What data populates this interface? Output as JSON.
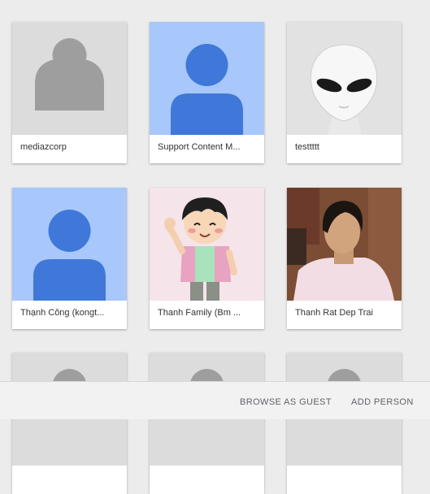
{
  "profiles": [
    {
      "name": "mediazcorp",
      "avatar": "default-gray-person-icon"
    },
    {
      "name": "Support Content M...",
      "avatar": "default-blue-person-icon"
    },
    {
      "name": "testtttt",
      "avatar": "alien-photo"
    },
    {
      "name": "Thạnh Công (kongt...",
      "avatar": "default-blue-person-icon"
    },
    {
      "name": "Thanh Family (Bm ...",
      "avatar": "cartoon-boy-photo"
    },
    {
      "name": "Thanh Rat Dep Trai",
      "avatar": "man-photo"
    },
    {
      "name": "",
      "avatar": "default-gray-person-icon"
    },
    {
      "name": "",
      "avatar": "default-gray-person-icon"
    },
    {
      "name": "",
      "avatar": "default-gray-person-icon"
    }
  ],
  "footer": {
    "browse_guest_label": "BROWSE AS GUEST",
    "add_person_label": "ADD PERSON"
  },
  "colors": {
    "page_background": "#ececec",
    "gray_avatar_bg": "#dcdcdc",
    "gray_avatar_figure": "#9e9e9e",
    "blue_avatar_bg": "#a8c7fa",
    "blue_avatar_figure": "#3f78d9",
    "footer_text": "#5f6368"
  }
}
